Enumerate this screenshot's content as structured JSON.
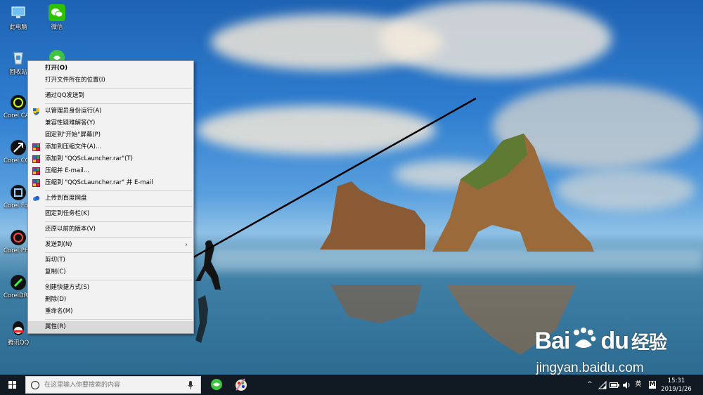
{
  "desktop": {
    "icons": [
      {
        "label": "此电脑",
        "icon": "this-pc-icon"
      },
      {
        "label": "微信",
        "icon": "wechat-icon"
      },
      {
        "label": "回收站",
        "icon": "recycle-bin-icon"
      },
      {
        "label": "",
        "icon": "green-app-icon"
      },
      {
        "label": "Corel CAPTU",
        "icon": "corel-capture-icon"
      },
      {
        "label": "Corel CONNE",
        "icon": "corel-connect-icon"
      },
      {
        "label": "Corel Fo Manage",
        "icon": "corel-font-manager-icon"
      },
      {
        "label": "Corel PHOTO-",
        "icon": "corel-photo-paint-icon"
      },
      {
        "label": "CorelDR 2018",
        "icon": "coreldraw-icon"
      },
      {
        "label": "腾讯QQ",
        "icon": "qq-icon"
      }
    ]
  },
  "context_menu": {
    "items": [
      {
        "type": "item",
        "label": "打开(O)",
        "bold": true
      },
      {
        "type": "item",
        "label": "打开文件所在的位置(I)"
      },
      {
        "type": "sep"
      },
      {
        "type": "item",
        "label": "通过QQ发送到"
      },
      {
        "type": "sep"
      },
      {
        "type": "item",
        "label": "以管理员身份运行(A)",
        "icon": "shield-icon"
      },
      {
        "type": "item",
        "label": "兼容性疑难解答(Y)"
      },
      {
        "type": "item",
        "label": "固定到\"开始\"屏幕(P)"
      },
      {
        "type": "item",
        "label": "添加到压缩文件(A)...",
        "icon": "winrar-icon"
      },
      {
        "type": "item",
        "label": "添加到 \"QQScLauncher.rar\"(T)",
        "icon": "winrar-icon"
      },
      {
        "type": "item",
        "label": "压缩并 E-mail...",
        "icon": "winrar-icon"
      },
      {
        "type": "item",
        "label": "压缩到 \"QQScLauncher.rar\" 并 E-mail",
        "icon": "winrar-icon"
      },
      {
        "type": "sep"
      },
      {
        "type": "item",
        "label": "上传到百度网盘",
        "icon": "baidu-netdisk-icon"
      },
      {
        "type": "sep"
      },
      {
        "type": "item",
        "label": "固定到任务栏(K)"
      },
      {
        "type": "sep"
      },
      {
        "type": "item",
        "label": "还原以前的版本(V)"
      },
      {
        "type": "sep"
      },
      {
        "type": "item",
        "label": "发送到(N)",
        "submenu": true
      },
      {
        "type": "sep"
      },
      {
        "type": "item",
        "label": "剪切(T)"
      },
      {
        "type": "item",
        "label": "复制(C)"
      },
      {
        "type": "sep"
      },
      {
        "type": "item",
        "label": "创建快捷方式(S)"
      },
      {
        "type": "item",
        "label": "删除(D)"
      },
      {
        "type": "item",
        "label": "重命名(M)"
      },
      {
        "type": "sep"
      },
      {
        "type": "item",
        "label": "属性(R)",
        "highlighted": true
      }
    ]
  },
  "taskbar": {
    "search_placeholder": "在这里输入你要搜索的内容",
    "apps": [
      "green-app-icon",
      "paint-app-icon"
    ],
    "tray": {
      "chevron": "^",
      "ime": "英",
      "ime_mode": "M"
    },
    "clock": {
      "time": "15:31",
      "date": "2019/1/26"
    }
  },
  "watermark": {
    "brand_prefix": "Bai",
    "brand_suffix": "du",
    "brand_cn": "经验",
    "url": "jingyan.baidu.com"
  }
}
